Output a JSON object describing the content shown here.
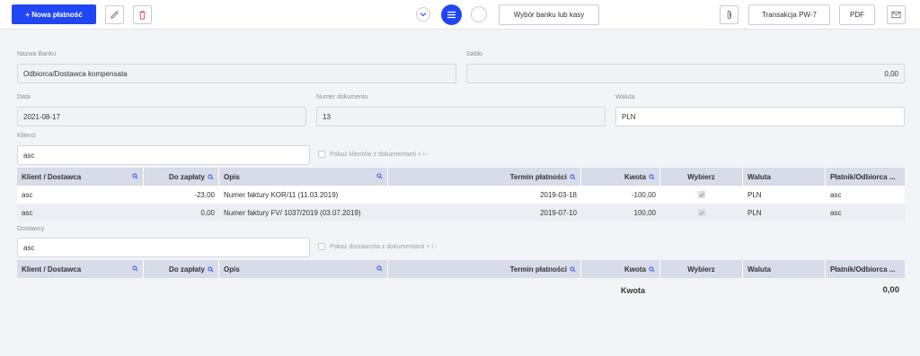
{
  "toolbar": {
    "new_payment": "+  Nowa płatność",
    "choose_bank": "Wybór banku lub kasy",
    "transaction": "Transakcja PW-7",
    "pdf": "PDF"
  },
  "form": {
    "bank_name_label": "Nazwa Banku",
    "bank_name_value": "Odbiorca/Dostawca kompensata",
    "balance_label": "Saldo",
    "balance_value": "0,00",
    "date_label": "Data",
    "date_value": "2021-08-17",
    "doc_number_label": "Numer dokumentu",
    "doc_number_value": "13",
    "currency_label": "Waluta",
    "currency_value": "PLN"
  },
  "clients": {
    "label": "Klienci",
    "search_value": "asc",
    "checkbox_label": "Pokaż klientów z dokumentami + i -",
    "columns": [
      "Klient / Dostawca",
      "Do zapłaty",
      "Opis",
      "Termin płatności",
      "Kwota",
      "Wybierz",
      "Waluta",
      "Płatnik/Odbiorca ..."
    ],
    "rows": [
      {
        "client": "asc",
        "due": "-23,00",
        "desc": "Numer faktury KOR/11 (11.03.2019)",
        "date": "2019-03-18",
        "amount": "-100,00",
        "currency": "PLN",
        "payer": "asc"
      },
      {
        "client": "asc",
        "due": "0,00",
        "desc": "Numer faktury FV/ 1037/2019 (03.07.2019)",
        "date": "2019-07-10",
        "amount": "100,00",
        "currency": "PLN",
        "payer": "asc"
      }
    ]
  },
  "suppliers": {
    "label": "Dostawcy",
    "search_value": "asc",
    "checkbox_label": "Pokaż dostawców z dokumentami + i -",
    "columns": [
      "Klient / Dostawca",
      "Do zapłaty",
      "Opis",
      "Termin płatności",
      "Kwota",
      "Wybierz",
      "Waluta",
      "Płatnik/Odbiorca ..."
    ]
  },
  "summary": {
    "amount_label": "Kwota",
    "amount_value": "0,00"
  },
  "colors": {
    "primary": "#2046f5",
    "delete_red": "#e5484d",
    "header_bg": "#d8dbe8"
  },
  "icons": [
    "plus-icon",
    "pencil-icon",
    "trash-icon",
    "chevron-down-icon",
    "menu-icon",
    "paperclip-icon",
    "envelope-icon",
    "search-icon"
  ]
}
